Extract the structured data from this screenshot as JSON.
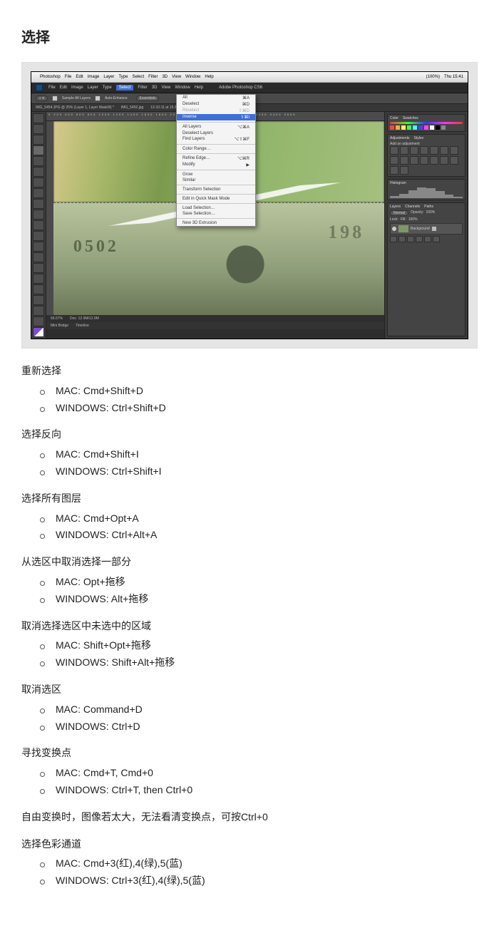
{
  "page_title": "选择",
  "mac_menubar": {
    "apple": "",
    "app": "Photoshop",
    "items": [
      "File",
      "Edit",
      "Image",
      "Layer",
      "Type",
      "Select",
      "Filter",
      "3D",
      "View",
      "Window",
      "Help"
    ],
    "right": [
      "Thu 15:41"
    ],
    "battery": "(100%)"
  },
  "selected_menu_index": 5,
  "options_bar": {
    "tool": "Sample All Layers",
    "auto": "Auto-Enhance"
  },
  "tabs": [
    "IMG_5454.JPG @ 25% (Layer 1, Layer Mask/8) *",
    "IMG_5452.jpg",
    "12-10-11 at 15.36.14.png @ 66.7% (RGB/8*) *"
  ],
  "ruler_marks": "0   200   400   600   800   1000  1200  1400  1600  1800  2000  2200  2400  2600  2800  3000  3200  3400  3600",
  "dropdown": [
    {
      "label": "All",
      "short": "⌘A"
    },
    {
      "label": "Deselect",
      "short": "⌘D"
    },
    {
      "label": "Reselect",
      "short": "⇧⌘D",
      "disabled": true
    },
    {
      "label": "Inverse",
      "short": "⇧⌘I",
      "hi": true
    },
    {
      "sep": true
    },
    {
      "label": "All Layers",
      "short": "⌥⌘A"
    },
    {
      "label": "Deselect Layers",
      "short": ""
    },
    {
      "label": "Find Layers",
      "short": "⌥⇧⌘F"
    },
    {
      "sep": true
    },
    {
      "label": "Color Range…",
      "short": ""
    },
    {
      "sep": true
    },
    {
      "label": "Refine Edge…",
      "short": "⌥⌘R"
    },
    {
      "label": "Modify",
      "short": "▶"
    },
    {
      "sep": true
    },
    {
      "label": "Grow",
      "short": ""
    },
    {
      "label": "Similar",
      "short": ""
    },
    {
      "sep": true
    },
    {
      "label": "Transform Selection",
      "short": ""
    },
    {
      "sep": true
    },
    {
      "label": "Edit in Quick Mask Mode",
      "short": ""
    },
    {
      "sep": true
    },
    {
      "label": "Load Selection…",
      "short": ""
    },
    {
      "label": "Save Selection…",
      "short": ""
    },
    {
      "sep": true
    },
    {
      "label": "New 3D Extrusion",
      "short": ""
    }
  ],
  "canvas_text": {
    "left": "0502",
    "right": "198"
  },
  "panels": {
    "color_tab": "Color",
    "swatches_tab": "Swatches",
    "adjustments_tab": "Adjustments",
    "styles_tab": "Styles",
    "add_adjustment": "Add an adjustment",
    "layers_tab": "Layers",
    "channels_tab": "Channels",
    "paths_tab": "Paths",
    "blend": "Normal",
    "opacity_label": "Opacity:",
    "opacity": "100%",
    "fill_label": "Fill:",
    "fill": "100%",
    "lock_label": "Lock:",
    "bg_layer": "Background",
    "essentials": "Essentials",
    "histogram_tab": "Histogram"
  },
  "status_bar": {
    "zoom": "66.67%",
    "doc": "Doc: 12.9M/12.9M",
    "mini": "Mini Bridge",
    "timeline": "Timeline"
  },
  "app_title": "Adobe Photoshop CS6",
  "groups": [
    {
      "title": "重新选择",
      "items": [
        "MAC: Cmd+Shift+D",
        "WINDOWS: Ctrl+Shift+D"
      ]
    },
    {
      "title": "选择反向",
      "items": [
        "MAC: Cmd+Shift+I",
        "WINDOWS: Ctrl+Shift+I"
      ]
    },
    {
      "title": "选择所有图层",
      "items": [
        "MAC: Cmd+Opt+A",
        "WINDOWS: Ctrl+Alt+A"
      ]
    },
    {
      "title": "从选区中取消选择一部分",
      "items": [
        "MAC: Opt+拖移",
        "WINDOWS: Alt+拖移"
      ]
    },
    {
      "title": "取消选择选区中未选中的区域",
      "items": [
        "MAC: Shift+Opt+拖移",
        "WINDOWS: Shift+Alt+拖移"
      ]
    },
    {
      "title": "取消选区",
      "items": [
        "MAC: Command+D",
        "WINDOWS: Ctrl+D"
      ]
    },
    {
      "title": "寻找变换点",
      "items": [
        "MAC: Cmd+T, Cmd+0",
        "WINDOWS: Ctrl+T, then Ctrl+0"
      ],
      "note": "自由变换时，图像若太大，无法看清变换点，可按Ctrl+0"
    },
    {
      "title": "选择色彩通道",
      "items": [
        "MAC: Cmd+3(红),4(绿),5(蓝)",
        "WINDOWS: Ctrl+3(红),4(绿),5(蓝)"
      ]
    }
  ]
}
